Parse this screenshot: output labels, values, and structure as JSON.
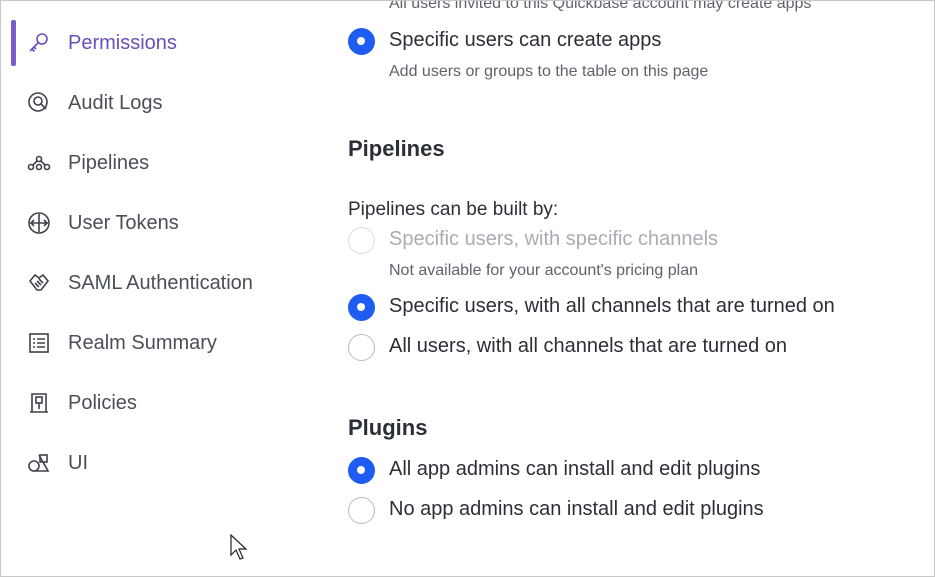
{
  "sidebar": {
    "items": [
      {
        "label": "Permissions",
        "icon": "key-icon",
        "active": true
      },
      {
        "label": "Audit Logs",
        "icon": "audit-search-icon",
        "active": false
      },
      {
        "label": "Pipelines",
        "icon": "pipelines-icon",
        "active": false
      },
      {
        "label": "User Tokens",
        "icon": "token-icon",
        "active": false
      },
      {
        "label": "SAML Authentication",
        "icon": "handshake-icon",
        "active": false
      },
      {
        "label": "Realm Summary",
        "icon": "list-icon",
        "active": false
      },
      {
        "label": "Policies",
        "icon": "policy-icon",
        "active": false
      },
      {
        "label": "UI",
        "icon": "shapes-icon",
        "active": false
      }
    ]
  },
  "app_creation": {
    "top_help": "All users invited to this Quickbase account may create apps",
    "option_specific": {
      "label": "Specific users can create apps",
      "checked": true
    },
    "option_specific_help": "Add users or groups to the table on this page"
  },
  "pipelines": {
    "title": "Pipelines",
    "built_by_label": "Pipelines can be built by:",
    "options": [
      {
        "label": "Specific users, with specific channels",
        "checked": false,
        "disabled": true,
        "help": "Not available for your account's pricing plan"
      },
      {
        "label": "Specific users, with all channels that are turned on",
        "checked": true,
        "disabled": false
      },
      {
        "label": "All users, with all channels that are turned on",
        "checked": false,
        "disabled": false
      }
    ]
  },
  "plugins": {
    "title": "Plugins",
    "options": [
      {
        "label": "All app admins can install and edit plugins",
        "checked": true
      },
      {
        "label": "No app admins can install and edit plugins",
        "checked": false
      }
    ]
  },
  "colors": {
    "accent": "#1f5cf2",
    "active_nav": "#6a4fb6",
    "active_bar": "#7b5cc6",
    "text": "#2b2f36",
    "muted": "#5e636b"
  }
}
